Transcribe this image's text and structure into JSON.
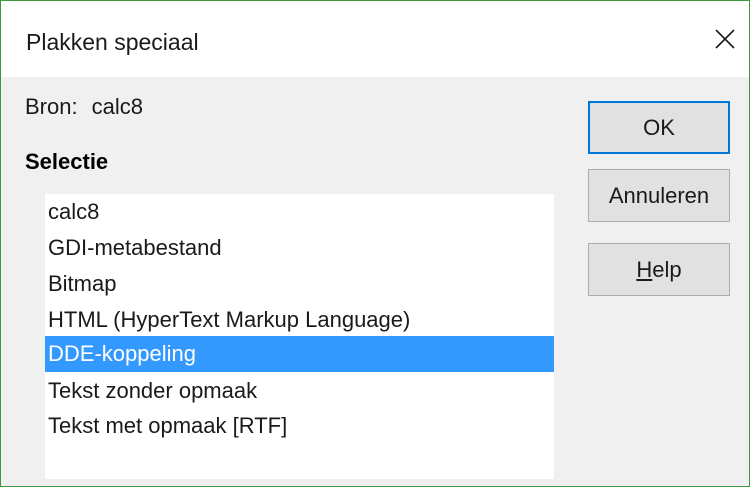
{
  "dialog": {
    "title": "Plakken speciaal"
  },
  "source": {
    "label": "Bron:",
    "value": "calc8"
  },
  "selection": {
    "heading": "Selectie",
    "items": [
      "calc8",
      "GDI-metabestand",
      "Bitmap",
      "HTML (HyperText Markup Language)",
      "DDE-koppeling",
      "Tekst zonder opmaak",
      "Tekst met opmaak [RTF]"
    ],
    "selected_item": "DDE-koppeling"
  },
  "buttons": {
    "ok": "OK",
    "cancel": "Annuleren",
    "help_mnemonic": "H",
    "help_rest": "elp"
  },
  "icons": {
    "close": "close-icon"
  },
  "colors": {
    "selection_highlight": "#3399ff",
    "default_button_border": "#0078d7",
    "window_border": "#3c9a3c"
  }
}
